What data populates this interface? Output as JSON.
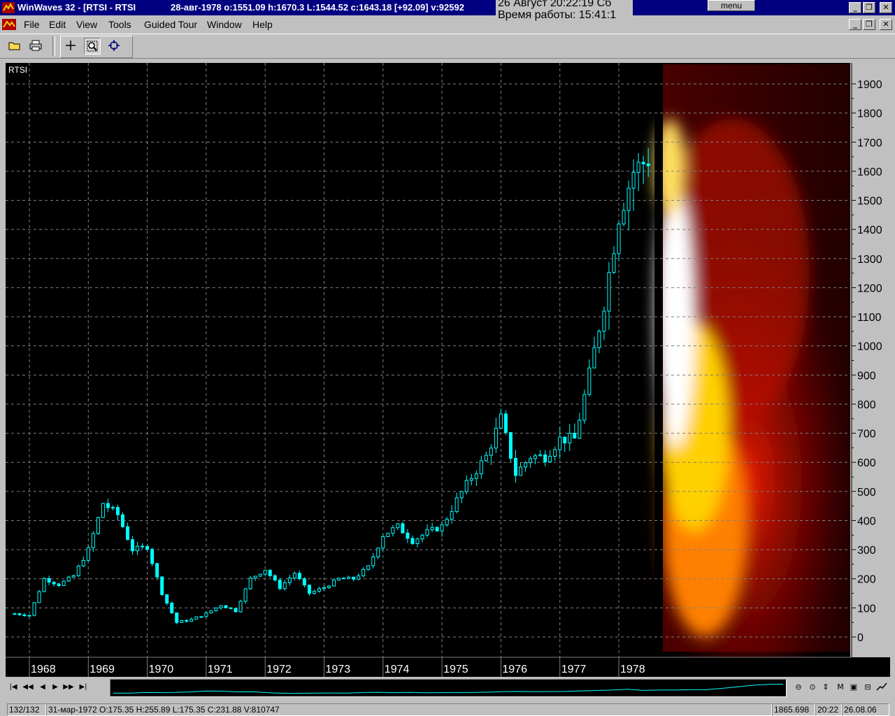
{
  "titlebar": {
    "title": "WinWaves 32 - [RTSI - RTSI",
    "quote": "28-авг-1978 o:1551.09 h:1670.3 L:1544.52 c:1643.18 [+92.09] v:92592"
  },
  "clock": {
    "line1": "26 Август 20:22:19 Сб",
    "line2": "Время работы: 15:41:1"
  },
  "menu_button": "menu",
  "window_buttons": {
    "minimize": "_",
    "restore": "❐",
    "close": "✕"
  },
  "menus": [
    "File",
    "Edit",
    "View",
    "Tools",
    "Guided Tour",
    "Window",
    "Help"
  ],
  "chart_data": {
    "type": "candlestick",
    "title": "RTSI",
    "y_ticks": [
      0,
      100,
      200,
      300,
      400,
      500,
      600,
      700,
      800,
      900,
      1000,
      1100,
      1200,
      1300,
      1400,
      1500,
      1600,
      1700,
      1800,
      1900
    ],
    "ylim": [
      -60,
      1960
    ],
    "x_ticks": [
      "1968",
      "1969",
      "1970",
      "1971",
      "1972",
      "1973",
      "1974",
      "1975",
      "1976",
      "1977",
      "1978"
    ],
    "grid": true,
    "series_color": "#00ffff",
    "heatmap_panel": "right",
    "quarterly_close": [
      {
        "x": 1967.75,
        "v": 80
      },
      {
        "x": 1968.0,
        "v": 75
      },
      {
        "x": 1968.25,
        "v": 200
      },
      {
        "x": 1968.5,
        "v": 180
      },
      {
        "x": 1968.75,
        "v": 210
      },
      {
        "x": 1969.0,
        "v": 300
      },
      {
        "x": 1969.25,
        "v": 460
      },
      {
        "x": 1969.5,
        "v": 420
      },
      {
        "x": 1969.75,
        "v": 300
      },
      {
        "x": 1970.0,
        "v": 310
      },
      {
        "x": 1970.25,
        "v": 150
      },
      {
        "x": 1970.5,
        "v": 50
      },
      {
        "x": 1970.75,
        "v": 60
      },
      {
        "x": 1971.0,
        "v": 80
      },
      {
        "x": 1971.25,
        "v": 110
      },
      {
        "x": 1971.5,
        "v": 90
      },
      {
        "x": 1971.75,
        "v": 200
      },
      {
        "x": 1972.0,
        "v": 232
      },
      {
        "x": 1972.25,
        "v": 170
      },
      {
        "x": 1972.5,
        "v": 220
      },
      {
        "x": 1972.75,
        "v": 150
      },
      {
        "x": 1973.0,
        "v": 170
      },
      {
        "x": 1973.25,
        "v": 200
      },
      {
        "x": 1973.5,
        "v": 200
      },
      {
        "x": 1973.75,
        "v": 240
      },
      {
        "x": 1974.0,
        "v": 350
      },
      {
        "x": 1974.25,
        "v": 380
      },
      {
        "x": 1974.5,
        "v": 330
      },
      {
        "x": 1974.75,
        "v": 360
      },
      {
        "x": 1975.0,
        "v": 380
      },
      {
        "x": 1975.25,
        "v": 470
      },
      {
        "x": 1975.5,
        "v": 550
      },
      {
        "x": 1975.75,
        "v": 620
      },
      {
        "x": 1976.0,
        "v": 750
      },
      {
        "x": 1976.25,
        "v": 560
      },
      {
        "x": 1976.5,
        "v": 620
      },
      {
        "x": 1976.75,
        "v": 620
      },
      {
        "x": 1977.0,
        "v": 680
      },
      {
        "x": 1977.25,
        "v": 680
      },
      {
        "x": 1977.5,
        "v": 900
      },
      {
        "x": 1977.75,
        "v": 1150
      },
      {
        "x": 1978.0,
        "v": 1450
      },
      {
        "x": 1978.25,
        "v": 1600
      },
      {
        "x": 1978.5,
        "v": 1643
      }
    ]
  },
  "status": {
    "count": "132/132",
    "bar_info": "31-мар-1972  O:175.35 H:255.89 L:175.35 C:231.88 V:810747",
    "price": "1865.698",
    "time": "20:22",
    "date": "26.08.06"
  }
}
